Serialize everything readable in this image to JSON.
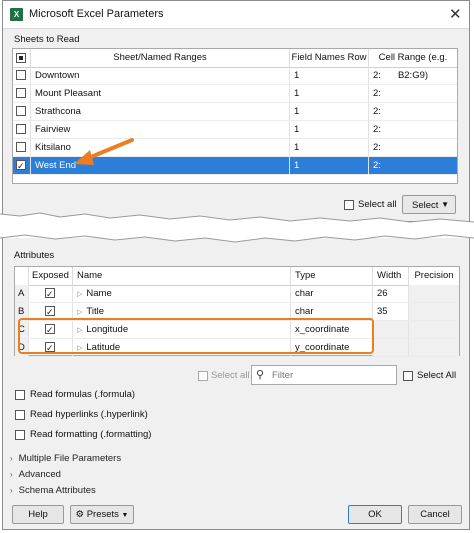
{
  "window": {
    "title": "Microsoft Excel Parameters",
    "app_icon": "excel-icon"
  },
  "sheets": {
    "section_label": "Sheets to Read",
    "headers": [
      "Sheet/Named Ranges",
      "Field Names Row",
      "Cell Range (e.g. B2:G9)"
    ],
    "rows": [
      {
        "name": "Downtown",
        "field_row": "1",
        "range": "2:",
        "checked": false,
        "selected": false
      },
      {
        "name": "Mount Pleasant",
        "field_row": "1",
        "range": "2:",
        "checked": false,
        "selected": false
      },
      {
        "name": "Strathcona",
        "field_row": "1",
        "range": "2:",
        "checked": false,
        "selected": false
      },
      {
        "name": "Fairview",
        "field_row": "1",
        "range": "2:",
        "checked": false,
        "selected": false
      },
      {
        "name": "Kitsilano",
        "field_row": "1",
        "range": "2:",
        "checked": false,
        "selected": false
      },
      {
        "name": "West End",
        "field_row": "1",
        "range": "2:",
        "checked": true,
        "selected": true
      }
    ],
    "select_all_label": "Select all",
    "select_button": "Select"
  },
  "attributes": {
    "section_label": "Attributes",
    "headers": [
      "Exposed",
      "Name",
      "Type",
      "Width",
      "Precision"
    ],
    "rows": [
      {
        "letter": "A",
        "name": "Name",
        "type": "char",
        "width": "26",
        "precision": ""
      },
      {
        "letter": "B",
        "name": "Title",
        "type": "char",
        "width": "35",
        "precision": ""
      },
      {
        "letter": "C",
        "name": "Longitude",
        "type": "x_coordinate",
        "width": "",
        "precision": ""
      },
      {
        "letter": "D",
        "name": "Latitude",
        "type": "y_coordinate",
        "width": "",
        "precision": ""
      }
    ],
    "select_all_disabled_label": "Select all",
    "filter_placeholder": "Filter",
    "select_all_label": "Select All"
  },
  "options": [
    "Read formulas (.formula)",
    "Read hyperlinks (.hyperlink)",
    "Read formatting (.formatting)"
  ],
  "collapsibles": [
    "Multiple File Parameters",
    "Advanced",
    "Schema Attributes"
  ],
  "buttons": {
    "help": "Help",
    "presets": "Presets",
    "ok": "OK",
    "cancel": "Cancel"
  },
  "colors": {
    "selection": "#2d7ed9",
    "highlight": "#ee7d22"
  }
}
